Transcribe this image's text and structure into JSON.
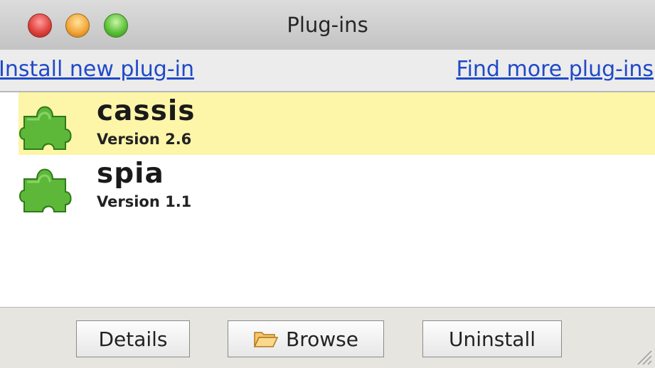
{
  "window": {
    "title": "Plug-ins"
  },
  "links": {
    "install": "Install new plug-in",
    "find_more": "Find more plug-ins"
  },
  "plugins": [
    {
      "name": "cassis",
      "version": "Version 2.6",
      "selected": true,
      "icon": "puzzle-piece-icon"
    },
    {
      "name": "spia",
      "version": "Version 1.1",
      "selected": false,
      "icon": "puzzle-piece-icon"
    }
  ],
  "buttons": {
    "details": "Details",
    "browse": "Browse",
    "browse_icon": "folder-open-icon",
    "uninstall": "Uninstall"
  },
  "colors": {
    "selected_row": "#fdf5a8",
    "link": "#1f49c8",
    "icon_green": "#4aa82c"
  }
}
